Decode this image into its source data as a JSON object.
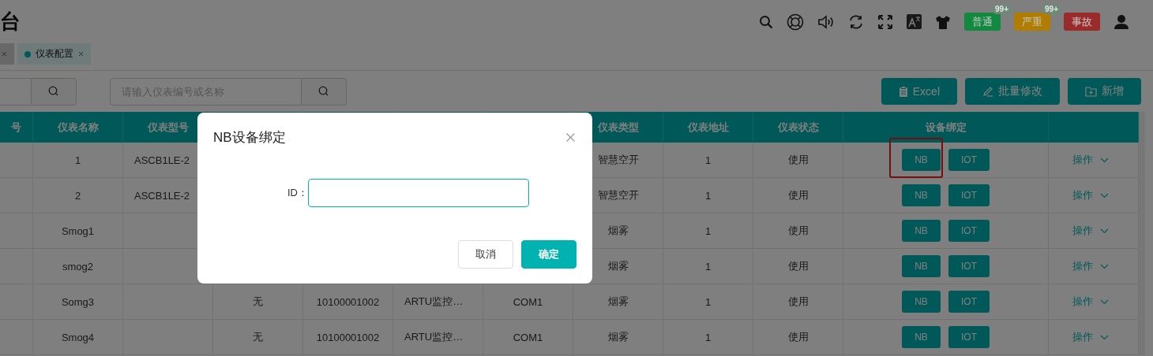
{
  "header": {
    "title": "台",
    "badges": [
      {
        "label": "普通",
        "count": "99+",
        "color": "#118a40"
      },
      {
        "label": "严重",
        "count": "99+",
        "color": "#b07d00"
      },
      {
        "label": "事故",
        "color": "#9b2b2b"
      }
    ]
  },
  "tabs": [
    {
      "selected": false
    },
    {
      "label": "仪表配置",
      "selected": true
    }
  ],
  "toolbar": {
    "search_placeholder": "请输入仪表编号或名称",
    "buttons": [
      {
        "kind": "excel",
        "label": "Excel"
      },
      {
        "kind": "edit",
        "label": "批量修改"
      },
      {
        "kind": "add",
        "label": "新增"
      }
    ]
  },
  "table": {
    "columns": [
      {
        "label": "号"
      },
      {
        "label": "仪表名称"
      },
      {
        "label": "仪表型号"
      },
      {},
      {},
      {},
      {},
      {
        "label": "仪表类型"
      },
      {
        "label": "仪表地址"
      },
      {
        "label": "仪表状态"
      },
      {
        "label": "设备绑定"
      },
      {}
    ],
    "rows": [
      {
        "cells": [
          null,
          "1",
          "ASCB1LE-2",
          null,
          null,
          null,
          null,
          "智慧空开",
          "1",
          "使用"
        ],
        "binding": [
          "NB",
          "IOT"
        ],
        "action": "操作",
        "highlighted": true
      },
      {
        "cells": [
          null,
          "2",
          "ASCB1LE-2",
          null,
          null,
          null,
          null,
          "智慧空开",
          "1",
          "使用"
        ],
        "binding": [
          "NB",
          "IOT"
        ],
        "action": "操作",
        "highlighted": false
      },
      {
        "cells": [
          null,
          "Smog1",
          null,
          null,
          null,
          null,
          null,
          "烟雾",
          "1",
          "使用"
        ],
        "binding": [
          "NB",
          "IOT"
        ],
        "action": "操作",
        "highlighted": false
      },
      {
        "cells": [
          null,
          "smog2",
          null,
          null,
          null,
          null,
          null,
          "烟雾",
          "1",
          "使用"
        ],
        "binding": [
          "NB",
          "IOT"
        ],
        "action": "操作",
        "highlighted": false
      },
      {
        "cells": [
          null,
          "Somg3",
          null,
          "无",
          "10100001002",
          "ARTU监控…",
          "COM1",
          "烟雾",
          "1",
          "使用"
        ],
        "binding": [
          "NB",
          "IOT"
        ],
        "action": "操作",
        "highlighted": false
      },
      {
        "cells": [
          null,
          "Smog4",
          null,
          "无",
          "10100001002",
          "ARTU监控…",
          "COM1",
          "烟雾",
          "1",
          "使用"
        ],
        "binding": [
          "NB",
          "IOT"
        ],
        "action": "操作",
        "highlighted": false
      }
    ]
  },
  "dialog": {
    "title": "NB设备绑定",
    "field_label": "ID：",
    "buttons": [
      {
        "kind": "default",
        "label": "取消"
      },
      {
        "kind": "primary",
        "label": "确定"
      }
    ]
  }
}
